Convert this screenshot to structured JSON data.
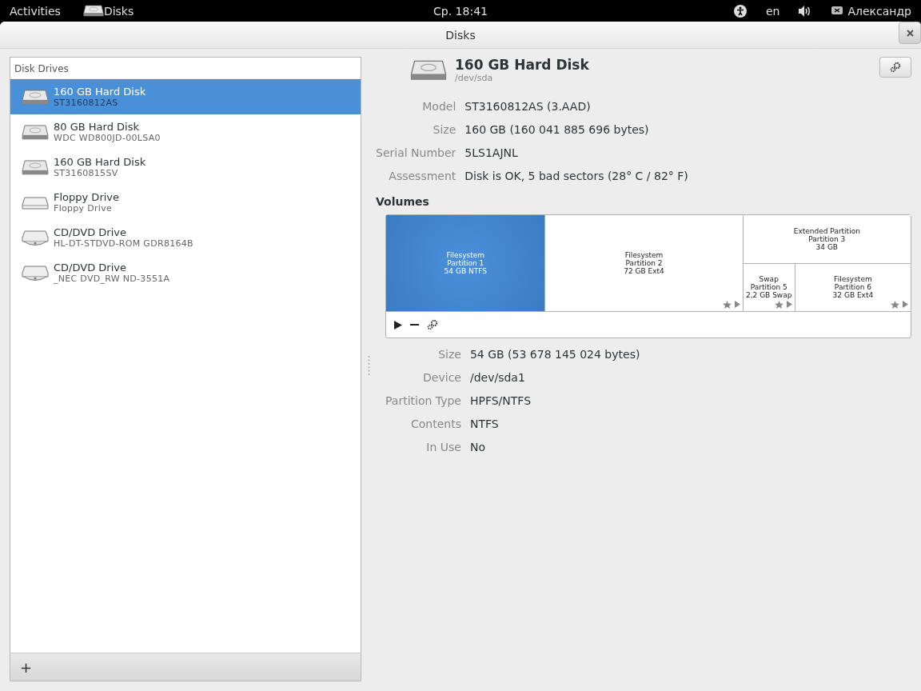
{
  "top_bar": {
    "activities": "Activities",
    "app": "Disks",
    "clock": "Ср. 18:41",
    "language": "en",
    "user": "Александр"
  },
  "window": {
    "title": "Disks"
  },
  "sidebar": {
    "heading": "Disk Drives",
    "items": [
      {
        "kind": "hdd",
        "title": "160 GB Hard Disk",
        "subtitle": "ST3160812AS",
        "selected": true
      },
      {
        "kind": "hdd",
        "title": "80 GB Hard Disk",
        "subtitle": "WDC WD800JD-00LSA0",
        "selected": false
      },
      {
        "kind": "hdd",
        "title": "160 GB Hard Disk",
        "subtitle": "ST3160815SV",
        "selected": false
      },
      {
        "kind": "floppy",
        "title": "Floppy Drive",
        "subtitle": "Floppy Drive",
        "selected": false
      },
      {
        "kind": "optical",
        "title": "CD/DVD Drive",
        "subtitle": "HL-DT-STDVD-ROM GDR8164B",
        "selected": false
      },
      {
        "kind": "optical",
        "title": "CD/DVD Drive",
        "subtitle": "_NEC DVD_RW ND-3551A",
        "selected": false
      }
    ],
    "add_button": "+"
  },
  "disk": {
    "title": "160 GB Hard Disk",
    "device": "/dev/sda",
    "properties": [
      {
        "label": "Model",
        "value": "ST3160812AS (3.AAD)"
      },
      {
        "label": "Size",
        "value": "160 GB (160 041 885 696 bytes)"
      },
      {
        "label": "Serial Number",
        "value": "5LS1AJNL"
      },
      {
        "label": "Assessment",
        "value": "Disk is OK, 5 bad sectors (28° C / 82° F)"
      }
    ]
  },
  "volumes": {
    "heading": "Volumes",
    "partitions": [
      {
        "kind": "leaf",
        "lines": [
          "Filesystem",
          "Partition 1",
          "54 GB NTFS"
        ],
        "selected": true
      },
      {
        "kind": "leaf",
        "lines": [
          "Filesystem",
          "Partition 2",
          "72 GB Ext4"
        ],
        "selected": false
      },
      {
        "kind": "extended",
        "lines": [
          "Extended Partition",
          "Partition 3",
          "34 GB"
        ],
        "selected": false,
        "children": [
          {
            "kind": "leaf",
            "lines": [
              "Swap",
              "Partition 5",
              "2,2 GB Swap"
            ],
            "selected": false
          },
          {
            "kind": "leaf",
            "lines": [
              "Filesystem",
              "Partition 6",
              "32 GB Ext4"
            ],
            "selected": false
          }
        ]
      }
    ],
    "properties": [
      {
        "label": "Size",
        "value": "54 GB (53 678 145 024 bytes)"
      },
      {
        "label": "Device",
        "value": "/dev/sda1"
      },
      {
        "label": "Partition Type",
        "value": "HPFS/NTFS"
      },
      {
        "label": "Contents",
        "value": "NTFS"
      },
      {
        "label": "In Use",
        "value": "No"
      }
    ]
  }
}
